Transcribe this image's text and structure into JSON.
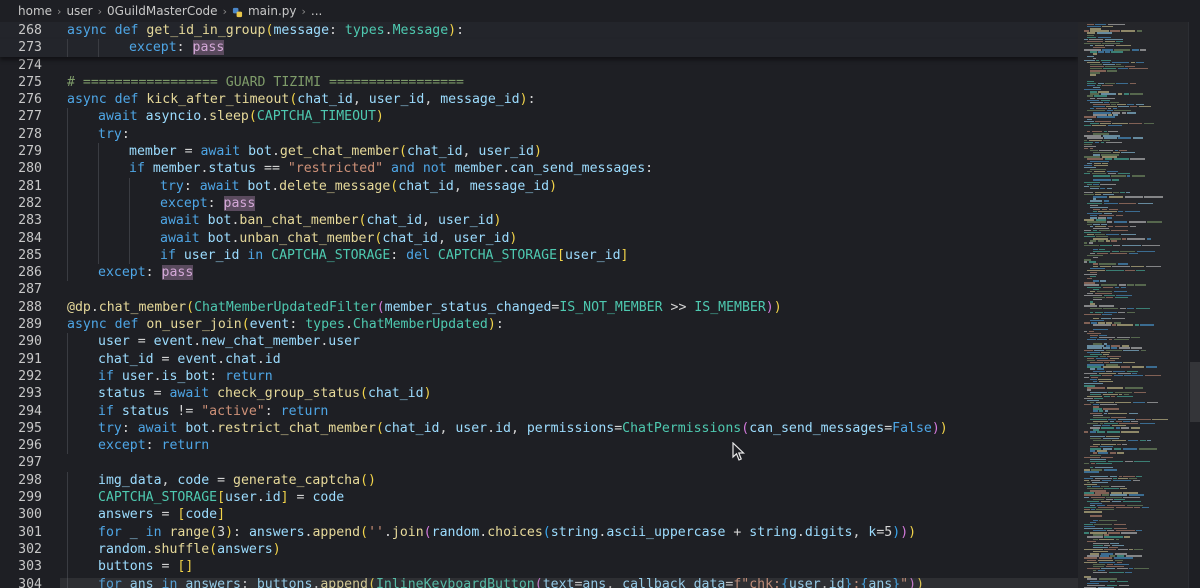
{
  "breadcrumb": {
    "items": [
      "home",
      "user",
      "0GuildMasterCode",
      "main.py",
      "..."
    ]
  },
  "colors": {
    "background": "#1e1f24",
    "keyword": "#4ea6e6",
    "function": "#e6d99a",
    "string": "#ce9178",
    "comment": "#7f9c6a",
    "type": "#4ec9b0"
  },
  "icons": {
    "file": "python-file-icon",
    "separator": "chevron-right-icon",
    "pointer": "mouse-pointer-icon"
  },
  "lines": [
    {
      "n": "268",
      "sticky": true,
      "tokens": [
        [
          "k",
          "async "
        ],
        [
          "k",
          "def "
        ],
        [
          "f",
          "get_id_in_group"
        ],
        [
          "b1",
          "("
        ],
        [
          "p",
          "message"
        ],
        [
          "w",
          ": "
        ],
        [
          "t",
          "types"
        ],
        [
          "w",
          "."
        ],
        [
          "t",
          "Message"
        ],
        [
          "b1",
          ")"
        ],
        [
          "w",
          ":"
        ]
      ]
    },
    {
      "n": "273",
      "sticky": true,
      "indent": 2,
      "tokens": [
        [
          "k",
          "except"
        ],
        [
          "w",
          ": "
        ],
        [
          "pass",
          "pass"
        ]
      ]
    },
    {
      "n": "274",
      "tokens": []
    },
    {
      "n": "275",
      "tokens": [
        [
          "cm",
          "# ================= GUARD TIZIMI ================="
        ]
      ]
    },
    {
      "n": "276",
      "tokens": [
        [
          "k",
          "async "
        ],
        [
          "k",
          "def "
        ],
        [
          "f",
          "kick_after_timeout"
        ],
        [
          "b1",
          "("
        ],
        [
          "p",
          "chat_id"
        ],
        [
          "w",
          ", "
        ],
        [
          "p",
          "user_id"
        ],
        [
          "w",
          ", "
        ],
        [
          "p",
          "message_id"
        ],
        [
          "b1",
          ")"
        ],
        [
          "w",
          ":"
        ]
      ]
    },
    {
      "n": "277",
      "indent": 1,
      "tokens": [
        [
          "k",
          "await "
        ],
        [
          "v",
          "asyncio"
        ],
        [
          "w",
          "."
        ],
        [
          "f",
          "sleep"
        ],
        [
          "b1",
          "("
        ],
        [
          "c",
          "CAPTCHA_TIMEOUT"
        ],
        [
          "b1",
          ")"
        ]
      ]
    },
    {
      "n": "278",
      "indent": 1,
      "tokens": [
        [
          "k",
          "try"
        ],
        [
          "w",
          ":"
        ]
      ]
    },
    {
      "n": "279",
      "indent": 2,
      "tokens": [
        [
          "v",
          "member"
        ],
        [
          "w",
          " = "
        ],
        [
          "k",
          "await "
        ],
        [
          "v",
          "bot"
        ],
        [
          "w",
          "."
        ],
        [
          "f",
          "get_chat_member"
        ],
        [
          "b1",
          "("
        ],
        [
          "v",
          "chat_id"
        ],
        [
          "w",
          ", "
        ],
        [
          "v",
          "user_id"
        ],
        [
          "b1",
          ")"
        ]
      ]
    },
    {
      "n": "280",
      "indent": 2,
      "tokens": [
        [
          "k",
          "if "
        ],
        [
          "v",
          "member"
        ],
        [
          "w",
          "."
        ],
        [
          "v",
          "status"
        ],
        [
          "w",
          " == "
        ],
        [
          "s",
          "\"restricted\""
        ],
        [
          "k",
          " and "
        ],
        [
          "k",
          "not "
        ],
        [
          "v",
          "member"
        ],
        [
          "w",
          "."
        ],
        [
          "v",
          "can_send_messages"
        ],
        [
          "w",
          ":"
        ]
      ]
    },
    {
      "n": "281",
      "indent": 3,
      "tokens": [
        [
          "k",
          "try"
        ],
        [
          "w",
          ": "
        ],
        [
          "k",
          "await "
        ],
        [
          "v",
          "bot"
        ],
        [
          "w",
          "."
        ],
        [
          "f",
          "delete_message"
        ],
        [
          "b1",
          "("
        ],
        [
          "v",
          "chat_id"
        ],
        [
          "w",
          ", "
        ],
        [
          "v",
          "message_id"
        ],
        [
          "b1",
          ")"
        ]
      ]
    },
    {
      "n": "282",
      "indent": 3,
      "tokens": [
        [
          "k",
          "except"
        ],
        [
          "w",
          ": "
        ],
        [
          "pass",
          "pass"
        ]
      ]
    },
    {
      "n": "283",
      "indent": 3,
      "tokens": [
        [
          "k",
          "await "
        ],
        [
          "v",
          "bot"
        ],
        [
          "w",
          "."
        ],
        [
          "f",
          "ban_chat_member"
        ],
        [
          "b1",
          "("
        ],
        [
          "v",
          "chat_id"
        ],
        [
          "w",
          ", "
        ],
        [
          "v",
          "user_id"
        ],
        [
          "b1",
          ")"
        ]
      ]
    },
    {
      "n": "284",
      "indent": 3,
      "tokens": [
        [
          "k",
          "await "
        ],
        [
          "v",
          "bot"
        ],
        [
          "w",
          "."
        ],
        [
          "f",
          "unban_chat_member"
        ],
        [
          "b1",
          "("
        ],
        [
          "v",
          "chat_id"
        ],
        [
          "w",
          ", "
        ],
        [
          "v",
          "user_id"
        ],
        [
          "b1",
          ")"
        ]
      ]
    },
    {
      "n": "285",
      "indent": 3,
      "tokens": [
        [
          "k",
          "if "
        ],
        [
          "v",
          "user_id"
        ],
        [
          "k",
          " in "
        ],
        [
          "c",
          "CAPTCHA_STORAGE"
        ],
        [
          "w",
          ": "
        ],
        [
          "k",
          "del "
        ],
        [
          "c",
          "CAPTCHA_STORAGE"
        ],
        [
          "b1",
          "["
        ],
        [
          "v",
          "user_id"
        ],
        [
          "b1",
          "]"
        ]
      ]
    },
    {
      "n": "286",
      "indent": 1,
      "tokens": [
        [
          "k",
          "except"
        ],
        [
          "w",
          ": "
        ],
        [
          "pass",
          "pass"
        ]
      ]
    },
    {
      "n": "287",
      "tokens": []
    },
    {
      "n": "288",
      "tokens": [
        [
          "f",
          "@dp"
        ],
        [
          "w",
          "."
        ],
        [
          "f",
          "chat_member"
        ],
        [
          "b1",
          "("
        ],
        [
          "t",
          "ChatMemberUpdatedFilter"
        ],
        [
          "b2",
          "("
        ],
        [
          "p",
          "member_status_changed"
        ],
        [
          "w",
          "="
        ],
        [
          "c",
          "IS_NOT_MEMBER"
        ],
        [
          "w",
          " >> "
        ],
        [
          "c",
          "IS_MEMBER"
        ],
        [
          "b2",
          ")"
        ],
        [
          "b1",
          ")"
        ]
      ]
    },
    {
      "n": "289",
      "tokens": [
        [
          "k",
          "async "
        ],
        [
          "k",
          "def "
        ],
        [
          "f",
          "on_user_join"
        ],
        [
          "b1",
          "("
        ],
        [
          "p",
          "event"
        ],
        [
          "w",
          ": "
        ],
        [
          "t",
          "types"
        ],
        [
          "w",
          "."
        ],
        [
          "t",
          "ChatMemberUpdated"
        ],
        [
          "b1",
          ")"
        ],
        [
          "w",
          ":"
        ]
      ]
    },
    {
      "n": "290",
      "indent": 1,
      "tokens": [
        [
          "v",
          "user"
        ],
        [
          "w",
          " = "
        ],
        [
          "v",
          "event"
        ],
        [
          "w",
          "."
        ],
        [
          "v",
          "new_chat_member"
        ],
        [
          "w",
          "."
        ],
        [
          "v",
          "user"
        ]
      ]
    },
    {
      "n": "291",
      "indent": 1,
      "tokens": [
        [
          "v",
          "chat_id"
        ],
        [
          "w",
          " = "
        ],
        [
          "v",
          "event"
        ],
        [
          "w",
          "."
        ],
        [
          "v",
          "chat"
        ],
        [
          "w",
          "."
        ],
        [
          "v",
          "id"
        ]
      ]
    },
    {
      "n": "292",
      "indent": 1,
      "tokens": [
        [
          "k",
          "if "
        ],
        [
          "v",
          "user"
        ],
        [
          "w",
          "."
        ],
        [
          "v",
          "is_bot"
        ],
        [
          "w",
          ": "
        ],
        [
          "k",
          "return"
        ]
      ]
    },
    {
      "n": "293",
      "indent": 1,
      "tokens": [
        [
          "v",
          "status"
        ],
        [
          "w",
          " = "
        ],
        [
          "k",
          "await "
        ],
        [
          "f",
          "check_group_status"
        ],
        [
          "b1",
          "("
        ],
        [
          "v",
          "chat_id"
        ],
        [
          "b1",
          ")"
        ]
      ]
    },
    {
      "n": "294",
      "indent": 1,
      "tokens": [
        [
          "k",
          "if "
        ],
        [
          "v",
          "status"
        ],
        [
          "w",
          " != "
        ],
        [
          "s",
          "\"active\""
        ],
        [
          "w",
          ": "
        ],
        [
          "k",
          "return"
        ]
      ]
    },
    {
      "n": "295",
      "indent": 1,
      "tokens": [
        [
          "k",
          "try"
        ],
        [
          "w",
          ": "
        ],
        [
          "k",
          "await "
        ],
        [
          "v",
          "bot"
        ],
        [
          "w",
          "."
        ],
        [
          "f",
          "restrict_chat_member"
        ],
        [
          "b1",
          "("
        ],
        [
          "v",
          "chat_id"
        ],
        [
          "w",
          ", "
        ],
        [
          "v",
          "user"
        ],
        [
          "w",
          "."
        ],
        [
          "v",
          "id"
        ],
        [
          "w",
          ", "
        ],
        [
          "p",
          "permissions"
        ],
        [
          "w",
          "="
        ],
        [
          "t",
          "ChatPermissions"
        ],
        [
          "b2",
          "("
        ],
        [
          "p",
          "can_send_messages"
        ],
        [
          "w",
          "="
        ],
        [
          "k",
          "False"
        ],
        [
          "b2",
          ")"
        ],
        [
          "b1",
          ")"
        ]
      ]
    },
    {
      "n": "296",
      "indent": 1,
      "tokens": [
        [
          "k",
          "except"
        ],
        [
          "w",
          ": "
        ],
        [
          "k",
          "return"
        ]
      ]
    },
    {
      "n": "297",
      "tokens": []
    },
    {
      "n": "298",
      "indent": 1,
      "tokens": [
        [
          "v",
          "img_data"
        ],
        [
          "w",
          ", "
        ],
        [
          "v",
          "code"
        ],
        [
          "w",
          " = "
        ],
        [
          "f",
          "generate_captcha"
        ],
        [
          "b1",
          "()"
        ]
      ]
    },
    {
      "n": "299",
      "indent": 1,
      "tokens": [
        [
          "c",
          "CAPTCHA_STORAGE"
        ],
        [
          "b1",
          "["
        ],
        [
          "v",
          "user"
        ],
        [
          "w",
          "."
        ],
        [
          "v",
          "id"
        ],
        [
          "b1",
          "]"
        ],
        [
          "w",
          " = "
        ],
        [
          "v",
          "code"
        ]
      ]
    },
    {
      "n": "300",
      "indent": 1,
      "tokens": [
        [
          "v",
          "answers"
        ],
        [
          "w",
          " = "
        ],
        [
          "b1",
          "["
        ],
        [
          "v",
          "code"
        ],
        [
          "b1",
          "]"
        ]
      ]
    },
    {
      "n": "301",
      "indent": 1,
      "tokens": [
        [
          "k",
          "for "
        ],
        [
          "v",
          "_"
        ],
        [
          "k",
          " in "
        ],
        [
          "f",
          "range"
        ],
        [
          "b1",
          "("
        ],
        [
          "w",
          "3"
        ],
        [
          "b1",
          ")"
        ],
        [
          "w",
          ": "
        ],
        [
          "v",
          "answers"
        ],
        [
          "w",
          "."
        ],
        [
          "f",
          "append"
        ],
        [
          "b1",
          "("
        ],
        [
          "s",
          "''"
        ],
        [
          "w",
          "."
        ],
        [
          "f",
          "join"
        ],
        [
          "b2",
          "("
        ],
        [
          "v",
          "random"
        ],
        [
          "w",
          "."
        ],
        [
          "f",
          "choices"
        ],
        [
          "b3",
          "("
        ],
        [
          "v",
          "string"
        ],
        [
          "w",
          "."
        ],
        [
          "v",
          "ascii_uppercase"
        ],
        [
          "w",
          " + "
        ],
        [
          "v",
          "string"
        ],
        [
          "w",
          "."
        ],
        [
          "v",
          "digits"
        ],
        [
          "w",
          ", "
        ],
        [
          "p",
          "k"
        ],
        [
          "w",
          "=5"
        ],
        [
          "b3",
          ")"
        ],
        [
          "b2",
          ")"
        ],
        [
          "b1",
          ")"
        ]
      ]
    },
    {
      "n": "302",
      "indent": 1,
      "tokens": [
        [
          "v",
          "random"
        ],
        [
          "w",
          "."
        ],
        [
          "f",
          "shuffle"
        ],
        [
          "b1",
          "("
        ],
        [
          "v",
          "answers"
        ],
        [
          "b1",
          ")"
        ]
      ]
    },
    {
      "n": "303",
      "indent": 1,
      "tokens": [
        [
          "v",
          "buttons"
        ],
        [
          "w",
          " = "
        ],
        [
          "b1",
          "[]"
        ]
      ]
    },
    {
      "n": "304",
      "indent": 1,
      "tokens": [
        [
          "k",
          "for "
        ],
        [
          "v",
          "ans"
        ],
        [
          "k",
          " in "
        ],
        [
          "v",
          "answers"
        ],
        [
          "w",
          ": "
        ],
        [
          "v",
          "buttons"
        ],
        [
          "w",
          "."
        ],
        [
          "f",
          "append"
        ],
        [
          "b1",
          "("
        ],
        [
          "t",
          "InlineKeyboardButton"
        ],
        [
          "b2",
          "("
        ],
        [
          "p",
          "text"
        ],
        [
          "w",
          "="
        ],
        [
          "v",
          "ans"
        ],
        [
          "w",
          ", "
        ],
        [
          "p",
          "callback_data"
        ],
        [
          "w",
          "="
        ],
        [
          "s",
          "f\"chk:"
        ],
        [
          "b3",
          "{"
        ],
        [
          "v",
          "user"
        ],
        [
          "w",
          "."
        ],
        [
          "v",
          "id"
        ],
        [
          "b3",
          "}"
        ],
        [
          "s",
          ":"
        ],
        [
          "b3",
          "{"
        ],
        [
          "v",
          "ans"
        ],
        [
          "b3",
          "}"
        ],
        [
          "s",
          "\""
        ],
        [
          "b2",
          ")"
        ],
        [
          "b1",
          ")"
        ]
      ]
    }
  ]
}
